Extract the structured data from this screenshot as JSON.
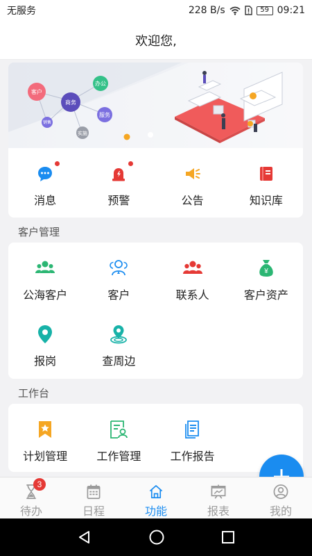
{
  "status_bar": {
    "carrier": "无服务",
    "speed": "228 B/s",
    "battery": "59",
    "time": "09:21"
  },
  "header": {
    "title": "欢迎您,"
  },
  "banner": {
    "bubbles": [
      "客户",
      "商务",
      "办公",
      "服务",
      "销售",
      "实施"
    ],
    "page_count": 2,
    "active_page": 1,
    "colors": {
      "accent": "#f5a623",
      "inactive_dot": "#ffffff"
    }
  },
  "quick_actions": [
    {
      "label": "消息",
      "icon": "chat-bubble-icon",
      "color": "#1a8cf0",
      "dot": true
    },
    {
      "label": "预警",
      "icon": "alarm-siren-icon",
      "color": "#e53935",
      "dot": true
    },
    {
      "label": "公告",
      "icon": "megaphone-icon",
      "color": "#f5a623",
      "dot": false
    },
    {
      "label": "知识库",
      "icon": "book-icon",
      "color": "#e53935",
      "dot": false
    }
  ],
  "customer_section": {
    "title": "客户管理",
    "items": [
      {
        "label": "公海客户",
        "icon": "group-icon",
        "color": "#2bb673"
      },
      {
        "label": "客户",
        "icon": "people-outline-icon",
        "color": "#1a8cf0"
      },
      {
        "label": "联系人",
        "icon": "contacts-icon",
        "color": "#e53935"
      },
      {
        "label": "客户资产",
        "icon": "money-bag-icon",
        "color": "#2bb673"
      },
      {
        "label": "报岗",
        "icon": "location-pin-icon",
        "color": "#17b2a8"
      },
      {
        "label": "查周边",
        "icon": "nearby-icon",
        "color": "#17b2a8"
      }
    ]
  },
  "workbench_section": {
    "title": "工作台",
    "items": [
      {
        "label": "计划管理",
        "icon": "plan-star-icon",
        "color": "#f5a623"
      },
      {
        "label": "工作管理",
        "icon": "work-profile-icon",
        "color": "#2bb673"
      },
      {
        "label": "工作报告",
        "icon": "report-document-icon",
        "color": "#1a8cf0"
      }
    ]
  },
  "fab": {
    "icon": "plus-icon",
    "color": "#1a8cf0"
  },
  "tab_bar": {
    "active": "功能",
    "items": [
      {
        "label": "待办",
        "icon": "hourglass-icon",
        "badge": "3"
      },
      {
        "label": "日程",
        "icon": "calendar-icon"
      },
      {
        "label": "功能",
        "icon": "home-icon"
      },
      {
        "label": "报表",
        "icon": "report-board-icon"
      },
      {
        "label": "我的",
        "icon": "user-circle-icon"
      }
    ]
  },
  "nav_bar": {
    "buttons": [
      "back-icon",
      "home-circle-icon",
      "recents-icon"
    ]
  }
}
